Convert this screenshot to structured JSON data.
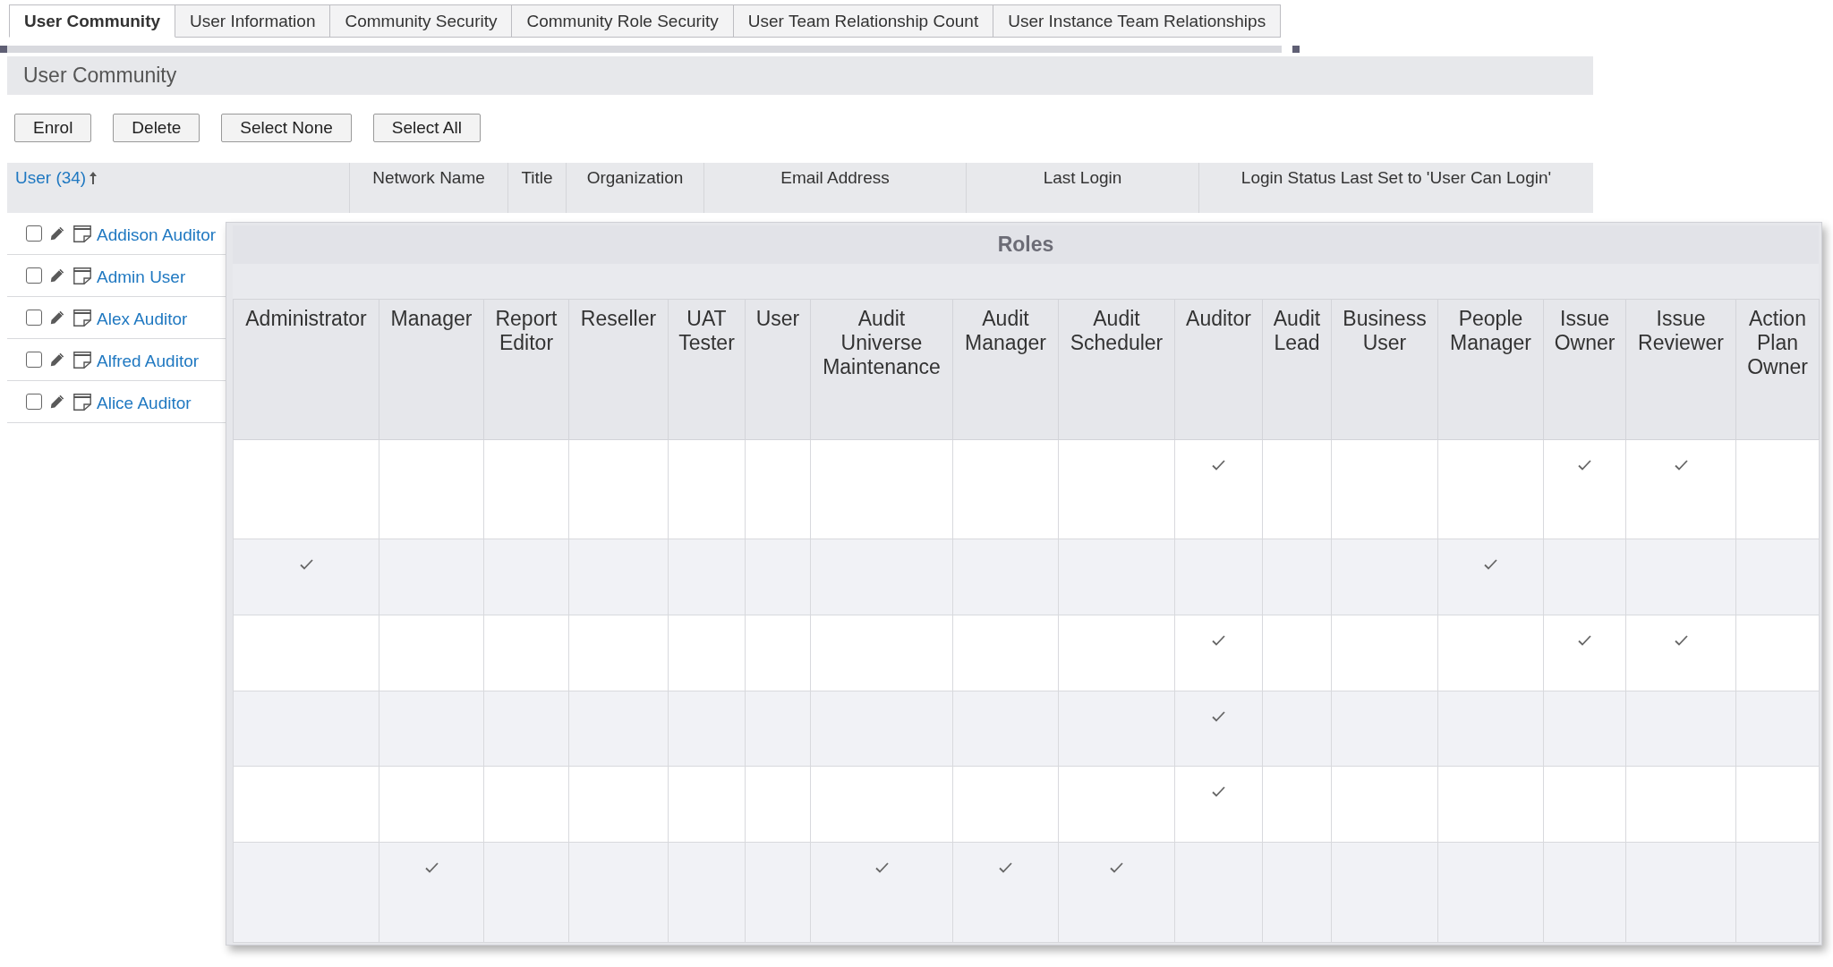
{
  "tabs": [
    {
      "label": "User Community",
      "selected": true
    },
    {
      "label": "User Information",
      "selected": false
    },
    {
      "label": "Community Security",
      "selected": false
    },
    {
      "label": "Community Role Security",
      "selected": false
    },
    {
      "label": "User Team Relationship Count",
      "selected": false
    },
    {
      "label": "User Instance Team Relationships",
      "selected": false
    }
  ],
  "panel": {
    "title": "User Community"
  },
  "buttons": [
    "Enrol",
    "Delete",
    "Select None",
    "Select All"
  ],
  "table": {
    "columns": [
      {
        "label": "User (34)",
        "kind": "link",
        "sorted": true
      },
      {
        "label": "Network Name",
        "kind": "text",
        "sorted": false
      },
      {
        "label": "Title",
        "kind": "text",
        "sorted": false
      },
      {
        "label": "Organization",
        "kind": "text",
        "sorted": false
      },
      {
        "label": "Email Address",
        "kind": "text",
        "sorted": false
      },
      {
        "label": "Last Login",
        "kind": "text",
        "sorted": false
      },
      {
        "label": "Login Status Last Set to 'User Can Login'",
        "kind": "text",
        "sorted": false
      }
    ],
    "rows": [
      {
        "name": "Addison Auditor",
        "checked": false
      },
      {
        "name": "Admin User",
        "checked": false
      },
      {
        "name": "Alex Auditor",
        "checked": false
      },
      {
        "name": "Alfred Auditor",
        "checked": false
      },
      {
        "name": "Alice Auditor",
        "checked": false
      }
    ]
  },
  "roles": {
    "title": "Roles",
    "columns": [
      "Administrator",
      "Manager",
      "Report Editor",
      "Reseller",
      "UAT Tester",
      "User",
      "Audit Universe Maintenance",
      "Audit Manager",
      "Audit Scheduler",
      "Auditor",
      "Audit Lead",
      "Business User",
      "People Manager",
      "Issue Owner",
      "Issue Reviewer",
      "Action Plan Owner"
    ],
    "rows": [
      {
        "cells": [
          {
            "checked": false
          },
          {
            "checked": false
          },
          {
            "checked": false
          },
          {
            "checked": false
          },
          {
            "checked": false
          },
          {
            "checked": false
          },
          {
            "checked": false
          },
          {
            "checked": false
          },
          {
            "checked": false
          },
          {
            "checked": true
          },
          {
            "checked": false
          },
          {
            "checked": false
          },
          {
            "checked": false
          },
          {
            "checked": true
          },
          {
            "checked": true
          },
          {
            "checked": false
          }
        ]
      },
      {
        "cells": [
          {
            "checked": true
          },
          {
            "checked": false
          },
          {
            "checked": false
          },
          {
            "checked": false
          },
          {
            "checked": false
          },
          {
            "checked": false
          },
          {
            "checked": false
          },
          {
            "checked": false
          },
          {
            "checked": false
          },
          {
            "checked": false
          },
          {
            "checked": false
          },
          {
            "checked": false
          },
          {
            "checked": true
          },
          {
            "checked": false
          },
          {
            "checked": false
          },
          {
            "checked": false
          }
        ]
      },
      {
        "cells": [
          {
            "checked": false
          },
          {
            "checked": false
          },
          {
            "checked": false
          },
          {
            "checked": false
          },
          {
            "checked": false
          },
          {
            "checked": false
          },
          {
            "checked": false
          },
          {
            "checked": false
          },
          {
            "checked": false
          },
          {
            "checked": true
          },
          {
            "checked": false
          },
          {
            "checked": false
          },
          {
            "checked": false
          },
          {
            "checked": true
          },
          {
            "checked": true
          },
          {
            "checked": false
          }
        ]
      },
      {
        "cells": [
          {
            "checked": false
          },
          {
            "checked": false
          },
          {
            "checked": false
          },
          {
            "checked": false
          },
          {
            "checked": false
          },
          {
            "checked": false
          },
          {
            "checked": false
          },
          {
            "checked": false
          },
          {
            "checked": false
          },
          {
            "checked": true
          },
          {
            "checked": false
          },
          {
            "checked": false
          },
          {
            "checked": false
          },
          {
            "checked": false
          },
          {
            "checked": false
          },
          {
            "checked": false
          }
        ]
      },
      {
        "cells": [
          {
            "checked": false
          },
          {
            "checked": false
          },
          {
            "checked": false
          },
          {
            "checked": false
          },
          {
            "checked": false
          },
          {
            "checked": false
          },
          {
            "checked": false
          },
          {
            "checked": false
          },
          {
            "checked": false
          },
          {
            "checked": true
          },
          {
            "checked": false
          },
          {
            "checked": false
          },
          {
            "checked": false
          },
          {
            "checked": false
          },
          {
            "checked": false
          },
          {
            "checked": false
          }
        ]
      },
      {
        "cells": [
          {
            "checked": false
          },
          {
            "checked": true
          },
          {
            "checked": false
          },
          {
            "checked": false
          },
          {
            "checked": false
          },
          {
            "checked": false
          },
          {
            "checked": true
          },
          {
            "checked": true
          },
          {
            "checked": true
          },
          {
            "checked": false
          },
          {
            "checked": false
          },
          {
            "checked": false
          },
          {
            "checked": false
          },
          {
            "checked": false
          },
          {
            "checked": false
          },
          {
            "checked": false
          }
        ]
      }
    ]
  }
}
